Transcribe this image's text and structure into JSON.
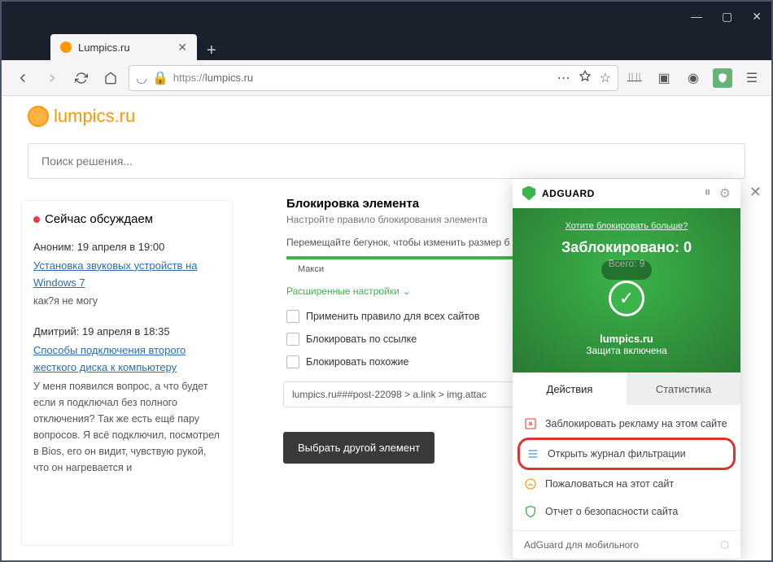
{
  "window": {
    "tab_title": "Lumpics.ru",
    "url_proto": "https://",
    "url_host": "lumpics.ru"
  },
  "page": {
    "logo_text": "lumpics.ru",
    "search_placeholder": "Поиск решения..."
  },
  "discuss": {
    "title": "Сейчас обсуждаем",
    "items": [
      {
        "meta": "Аноним: 19 апреля в 19:00",
        "link": "Установка звуковых устройств на Windows 7",
        "body": "как?я не могу"
      },
      {
        "meta": "Дмитрий: 19 апреля в 18:35",
        "link": "Способы подключения второго жесткого диска к компьютеру",
        "body": "У меня появился вопрос, а что будет если я подключал без полного отключения? Так же есть ещё пару вопросов. Я всё подключил, посмотрел в Bios, его он видит, чувствую рукой, что он нагревается и"
      }
    ]
  },
  "blocker": {
    "title": "Блокировка элемента",
    "subtitle": "Настройте правило блокирования элемента",
    "hint": "Перемещайте бегунок, чтобы изменить размер б",
    "slider_label": "Макси",
    "advanced": "Расширенные настройки",
    "checks": [
      "Применить правило для всех сайтов",
      "Блокировать по ссылке",
      "Блокировать похожие"
    ],
    "rule": "lumpics.ru###post-22098 > a.link > img.attac",
    "choose_btn": "Выбрать другой элемент"
  },
  "adguard": {
    "name": "ADGUARD",
    "more_link": "Хотите блокировать больше?",
    "blocked_label": "Заблокировано: 0",
    "total_label": "Всего: 9",
    "site": "lumpics.ru",
    "protect": "Защита включена",
    "tabs": {
      "actions": "Действия",
      "stats": "Статистика"
    },
    "actions": [
      "Заблокировать рекламу на этом сайте",
      "Открыть журнал фильтрации",
      "Пожаловаться на этот сайт",
      "Отчет о безопасности сайта"
    ],
    "footer": "AdGuard для мобильного"
  }
}
